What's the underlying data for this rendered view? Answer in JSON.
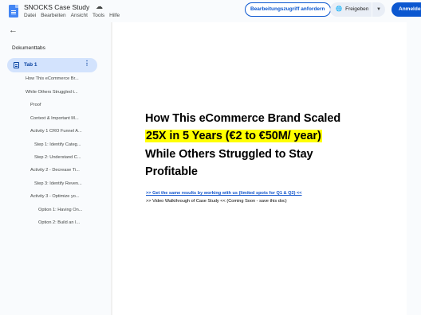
{
  "app": {
    "title": "SNOCKS Case Study",
    "menu": [
      "Datei",
      "Bearbeiten",
      "Ansicht",
      "Tools",
      "Hilfe"
    ],
    "request_access_label": "Bearbeitungszugriff anfordern",
    "share_label": "Freigeben",
    "signin_label": "Anmelden",
    "accent_color": "#0b57d0"
  },
  "sidebar": {
    "section_title": "Dokumenttabs",
    "active_tab": "Tab 1",
    "outline": [
      "How This eCommerce Br...",
      "While Others Struggled t...",
      "Proof",
      "Context & Important M...",
      "Activity 1 CRO Funnel A...",
      "Step 1: Identify Categ...",
      "Step 2: Understand C...",
      "Activity 2 - Decrease Ti...",
      "Step 3: Identify Reven...",
      "Activity 3 - Optimize yo...",
      "Option 1: Having On...",
      "Option 2: Build an I..."
    ]
  },
  "document": {
    "heading_line1": "How This eCommerce Brand Scaled",
    "heading_line2": "25X in 5 Years (€2 to €50M/ year)",
    "heading_line3": "While Others Struggled to Stay",
    "heading_line4": "Profitable",
    "cta_link": ">> Get the same results by working with us (limited spots for Q1 & Q2) <<",
    "video_note": ">> Video Walkthrough of Case Study << (Coming Soon - save this doc)",
    "highlight_color": "#ffff00"
  }
}
